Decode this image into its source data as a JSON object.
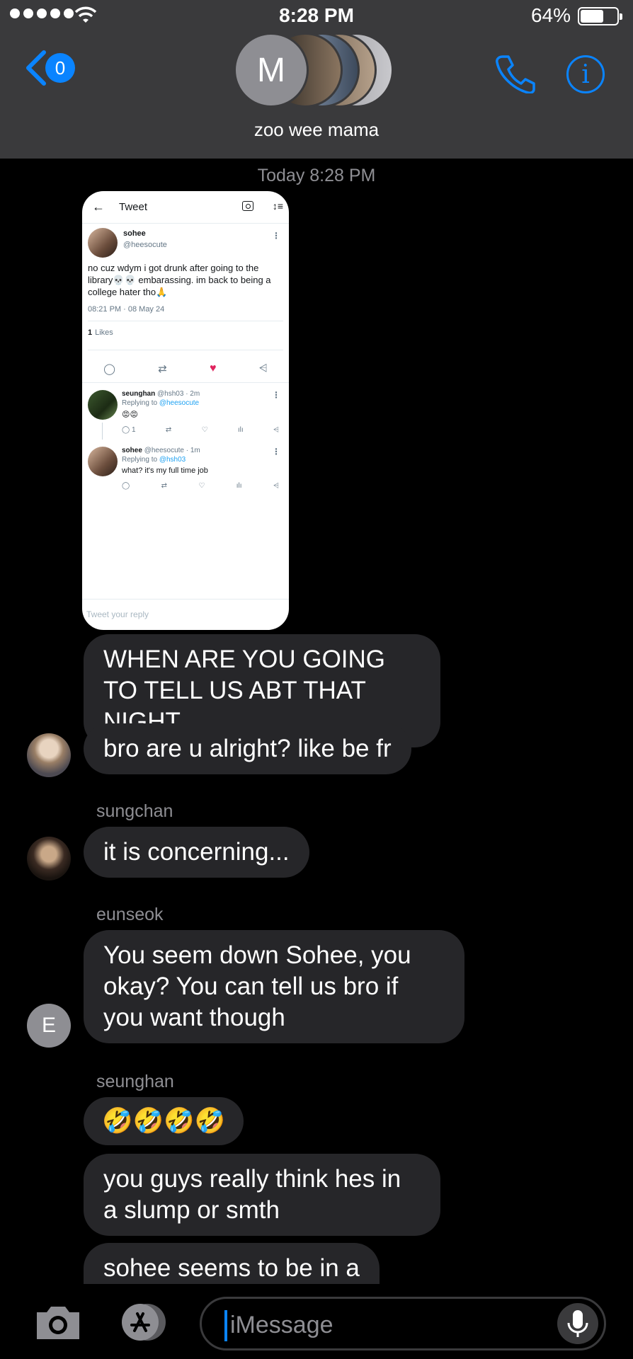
{
  "status_bar": {
    "time": "8:28 PM",
    "battery_pct": "64%",
    "battery_level": 0.64,
    "signal_bars": 5
  },
  "header": {
    "back_badge": "0",
    "avatar_initial": "M",
    "group_name": "zoo wee mama"
  },
  "timestamp": "Today 8:28 PM",
  "tweet_screenshot": {
    "header_title": "Tweet",
    "author_name": "sohee",
    "author_handle": "@heesocute",
    "text": "no cuz wdym i got drunk after going to the library💀💀 embarassing. im back to being a college hater tho🙏",
    "date": "08:21 PM · 08 May 24",
    "likes_count": "1",
    "likes_label": "Likes",
    "replies": [
      {
        "name": "seunghan",
        "meta": "@hsh03 · 2m",
        "replying_label": "Replying to",
        "replying_to": "@heesocute",
        "text": "😡😡",
        "reply_count": "1"
      },
      {
        "name": "sohee",
        "meta": "@heesocute · 1m",
        "replying_label": "Replying to",
        "replying_to": "@hsh03",
        "text": "what? it's my full time job",
        "reply_count": ""
      }
    ],
    "reply_placeholder": "Tweet your reply"
  },
  "messages": [
    {
      "text": "WHEN ARE YOU GOING TO TELL US ABT THAT NIGHT"
    },
    {
      "text": "bro are u alright? like be fr"
    },
    {
      "sender": "sungchan",
      "text": "it is concerning..."
    },
    {
      "sender": "eunseok",
      "text": "You seem down Sohee, you okay? You can tell us bro if you want though",
      "avatar_initial": "E"
    },
    {
      "sender": "seunghan",
      "text": "🤣🤣🤣🤣"
    },
    {
      "text": "you guys really think hes in a slump or smth"
    },
    {
      "text": "sohee seems to be in a"
    }
  ],
  "input": {
    "placeholder": "iMessage"
  },
  "colors": {
    "accent": "#0a84ff",
    "bubble": "#262629",
    "header": "#3a3a3c",
    "like": "#e0245e"
  }
}
